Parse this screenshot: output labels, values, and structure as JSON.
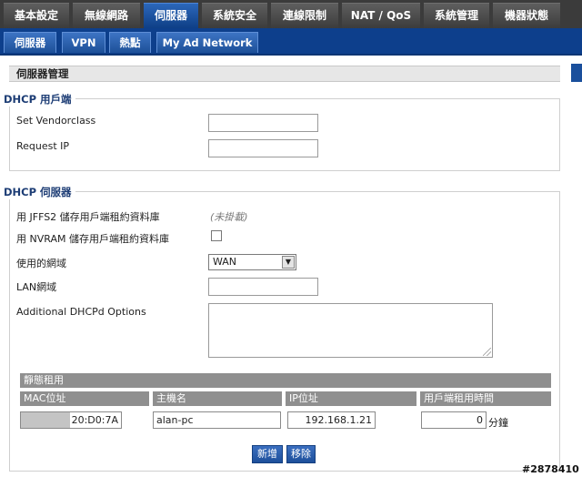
{
  "top_tabs": [
    "基本設定",
    "無線網路",
    "伺服器",
    "系統安全",
    "連線限制",
    "NAT / QoS",
    "系統管理",
    "機器狀態"
  ],
  "sub_tabs": [
    "伺服器",
    "VPN",
    "熱點",
    "My Ad Network"
  ],
  "section_title": "伺服器管理",
  "dhcp_client": {
    "legend": "DHCP 用戶端",
    "vendorclass_label": "Set Vendorclass",
    "vendorclass_value": "",
    "request_ip_label": "Request IP",
    "request_ip_value": ""
  },
  "dhcp_server": {
    "legend": "DHCP 伺服器",
    "jffs2_label": "用 JFFS2 儲存用戶端租約資料庫",
    "jffs2_note": "(未掛載)",
    "nvram_label": "用 NVRAM 儲存用戶端租約資料庫",
    "domain_label": "使用的網域",
    "domain_value": "WAN",
    "dropdown_arrow": "▼",
    "lan_domain_label": "LAN網域",
    "lan_domain_value": "",
    "options_label": "Additional DHCPd Options"
  },
  "static_lease": {
    "title": "靜態租用",
    "headers": [
      "MAC位址",
      "主機名",
      "IP位址",
      "用戶端租用時間"
    ],
    "row": {
      "mac": "20:D0:7A",
      "hostname": "alan-pc",
      "ip": "192.168.1.21",
      "lease_time": "0",
      "unit": "分鐘"
    }
  },
  "buttons": {
    "add": "新增",
    "remove": "移除"
  },
  "watermark": "#2878410"
}
